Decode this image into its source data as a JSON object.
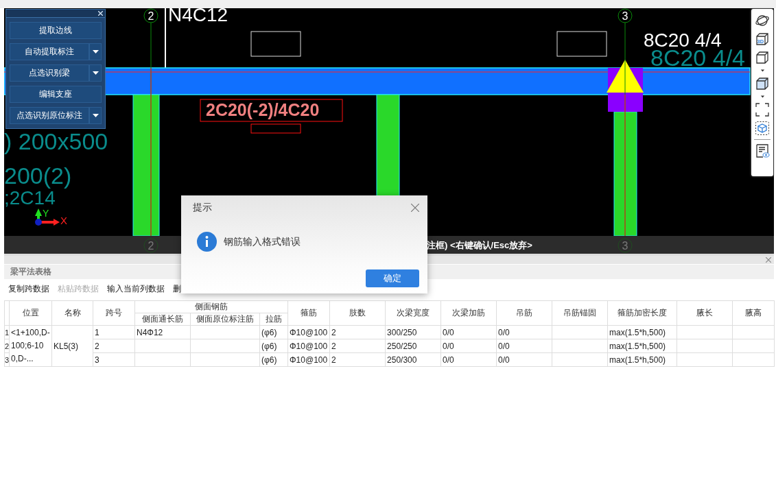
{
  "cad": {
    "axis_bubbles": [
      {
        "text": "2"
      },
      {
        "text": "3"
      },
      {
        "text": "2"
      },
      {
        "text": "3"
      }
    ],
    "annotations": [
      {
        "text": "N4C12",
        "color": "#ffffff"
      },
      {
        "text": "8C20 4/4",
        "color": "#ffffff"
      },
      {
        "text": "8C20 4/4",
        "color": "#0a8c8c"
      },
      {
        "text": "2C20(-2)/4C20",
        "color": "#f08080"
      },
      {
        "text": ") 200x500",
        "color": "#0a8c8c"
      },
      {
        "text": "200(2)",
        "color": "#0a8c8c"
      },
      {
        "text": ";2C14",
        "color": "#0a8c8c"
      }
    ],
    "axis_labels": [
      "Y",
      "X"
    ],
    "status_text": "注框)  <右键确认/Esc放弃>"
  },
  "view_toolbar": {
    "badge": "3D"
  },
  "tool_panel": {
    "buttons": [
      {
        "label": "提取边线",
        "dropdown": false
      },
      {
        "label": "自动提取标注",
        "dropdown": true
      },
      {
        "label": "点选识别梁",
        "dropdown": true
      },
      {
        "label": "编辑支座",
        "dropdown": false
      },
      {
        "label": "点选识别原位标注",
        "dropdown": true
      }
    ]
  },
  "table_panel": {
    "title": "梁平法表格",
    "toolbar": [
      {
        "label": "复制跨数据",
        "disabled": false
      },
      {
        "label": "粘贴跨数据",
        "disabled": true
      },
      {
        "label": "输入当前列数据",
        "disabled": false
      },
      {
        "label": "删",
        "disabled": false
      }
    ],
    "columns": [
      {
        "label": "位置"
      },
      {
        "label": "名称"
      },
      {
        "label": "跨号"
      },
      {
        "label": "侧面钢筋",
        "children": [
          {
            "label": "侧面通长筋"
          },
          {
            "label": "侧面原位标注筋"
          },
          {
            "label": "拉筋"
          }
        ]
      },
      {
        "label": "箍筋"
      },
      {
        "label": "肢数"
      },
      {
        "label": "次梁宽度"
      },
      {
        "label": "次梁加筋"
      },
      {
        "label": "吊筋"
      },
      {
        "label": "吊筋锚固"
      },
      {
        "label": "箍筋加密长度"
      },
      {
        "label": "腋长"
      },
      {
        "label": "腋高"
      }
    ],
    "location": "<1+100,D-100;6-100,D-...",
    "name": "KL5(3)",
    "spans": [
      {
        "row_number": "1",
        "span_no": "1",
        "side_through": "N4Φ12",
        "tie": "(φ6)",
        "stirrup": "Φ10@100",
        "legs": "2",
        "secondary_width": "300/250",
        "secondary_rebar": "0/0",
        "hanger": "0/0",
        "dense_length": "max(1.5*h,500)"
      },
      {
        "row_number": "2",
        "span_no": "2",
        "tie": "(φ6)",
        "stirrup": "Φ10@100",
        "legs": "2",
        "secondary_width": "250/250",
        "secondary_rebar": "0/0",
        "hanger": "0/0",
        "dense_length": "max(1.5*h,500)"
      },
      {
        "row_number": "3",
        "span_no": "3",
        "tie": "(φ6)",
        "stirrup": "Φ10@100",
        "legs": "2",
        "secondary_width": "250/300",
        "secondary_rebar": "0/0",
        "hanger": "0/0",
        "dense_length": "max(1.5*h,500)"
      }
    ]
  },
  "dialog": {
    "title": "提示",
    "message": "钢筋输入格式错误",
    "button": "确定"
  }
}
